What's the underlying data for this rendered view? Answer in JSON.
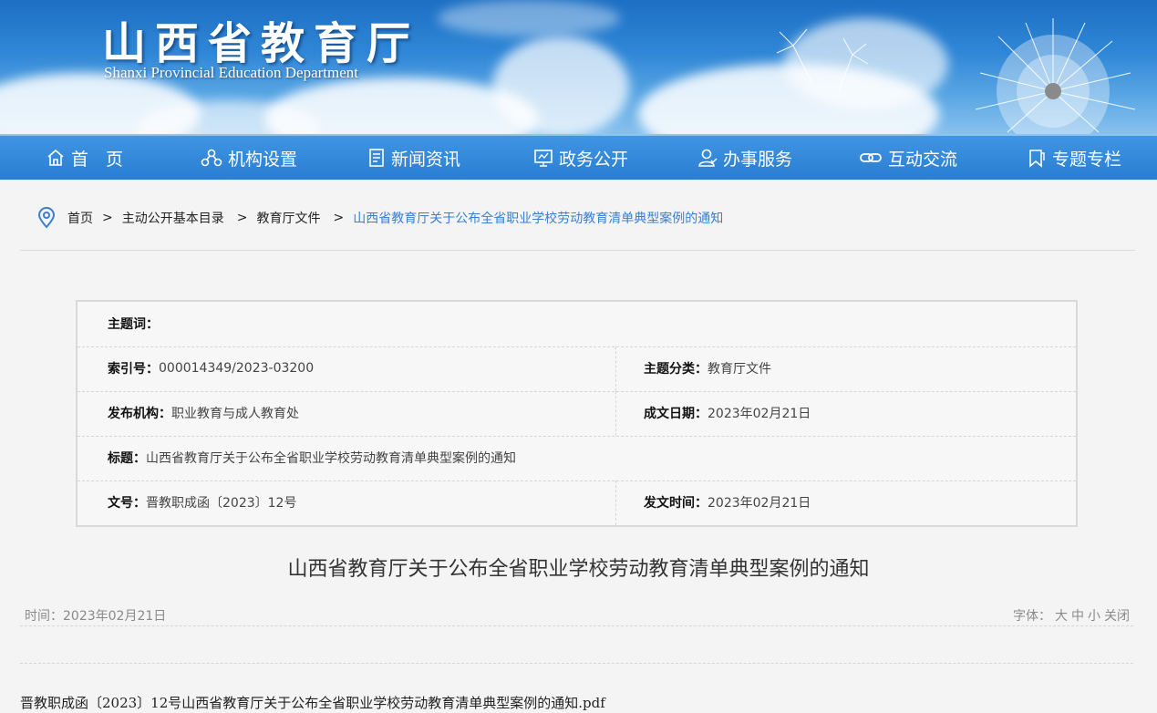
{
  "header": {
    "title_cn": "山西省教育厅",
    "title_en": "Shanxi Provincial Education Department"
  },
  "nav": [
    {
      "label": "首　页",
      "icon": "home-icon"
    },
    {
      "label": "机构设置",
      "icon": "org-chart-icon"
    },
    {
      "label": "新闻资讯",
      "icon": "news-icon"
    },
    {
      "label": "政务公开",
      "icon": "gov-open-icon"
    },
    {
      "label": "办事服务",
      "icon": "user-service-icon"
    },
    {
      "label": "互动交流",
      "icon": "link-icon"
    },
    {
      "label": "专题专栏",
      "icon": "bookmark-icon"
    }
  ],
  "breadcrumb": {
    "icon": "location-pin-icon",
    "items": [
      "首页",
      "主动公开基本目录",
      "教育厅文件"
    ],
    "current": "山西省教育厅关于公布全省职业学校劳动教育清单典型案例的通知",
    "separator": ">"
  },
  "meta": {
    "keywords_label": "主题词：",
    "keywords_value": "",
    "index_label": "索引号：",
    "index_value": "000014349/2023-03200",
    "category_label": "主题分类：",
    "category_value": "教育厅文件",
    "issuer_label": "发布机构：",
    "issuer_value": "职业教育与成人教育处",
    "date_label": "成文日期：",
    "date_value": "2023年02月21日",
    "title_label": "标题：",
    "title_value": "山西省教育厅关于公布全省职业学校劳动教育清单典型案例的通知",
    "doc_no_label": "文号：",
    "doc_no_value": "晋教职成函〔2023〕12号",
    "pub_time_label": "发文时间：",
    "pub_time_value": "2023年02月21日"
  },
  "article": {
    "title": "山西省教育厅关于公布全省职业学校劳动教育清单典型案例的通知",
    "time_label": "时间：",
    "time_value": "2023年02月21日",
    "font_label": "字体：",
    "font_large": "大",
    "font_medium": "中",
    "font_small": "小",
    "close": "关闭",
    "attachment": "晋教职成函〔2023〕12号山西省教育厅关于公布全省职业学校劳动教育清单典型案例的通知.pdf"
  },
  "colors": {
    "nav_bg": "#2f86d9",
    "banner_blue": "#1d6fc4",
    "breadcrumb_current": "#3a7fd0"
  }
}
